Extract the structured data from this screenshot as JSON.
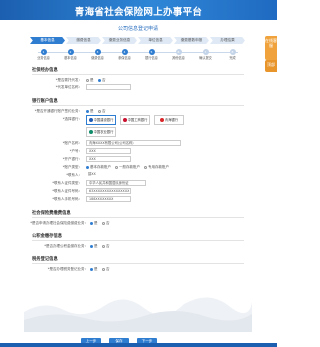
{
  "header": {
    "title": "青海省社会保险网上办事平台"
  },
  "side": {
    "btn1": "在线客服",
    "btn2": "顶部"
  },
  "form": {
    "title": "公司信息登记申请",
    "steps": [
      "基本信息",
      "缴费信息",
      "缴费业务信息",
      "单位信息",
      "缴费基数申报",
      "办理结果"
    ],
    "substeps": [
      "业务信息",
      "基本信息",
      "缴费信息",
      "参保信息",
      "银行信息",
      "其他信息",
      "确认提交",
      "完成"
    ],
    "sections": {
      "s1": "社保经办信息",
      "s2": "银行账户信息",
      "s3": "社会保险费缴费信息",
      "s4": "公积金缴存信息",
      "s5": "税务登记信息"
    },
    "fields": {
      "f1_label": "*是否委托代发：",
      "f1_opt1": "是",
      "f1_opt2": "否",
      "f2_label": "*代发单位名称：",
      "bank_q_label": "*是否开通银行账户签约业务：",
      "bank_q_opt1": "是",
      "bank_q_opt2": "否",
      "bank_label": "*选择银行：",
      "banks": [
        "中国建设银行",
        "中国工商银行",
        "青海银行",
        "中国农业银行"
      ],
      "acct_name_label": "*账户名称：",
      "acct_name_value": "青海XXXX有限公司(公司名称)",
      "acct_no_label": "*户号：",
      "acct_no_value": "XXX",
      "bank_name_label": "*开户银行：",
      "bank_name_value": "XXX",
      "type_label": "*账户类型：",
      "type_opts": [
        "基本存款账户",
        "一般存款账户",
        "专用存款账户"
      ],
      "contact_label": "*联系人：",
      "contact_value": "聂XX",
      "id_label": "*联系人证件类型：",
      "id_value": "中华人民共和国居民身份证",
      "idno_label": "*联系人证件号码：",
      "idno_value": "63XXXXXXXXXXXXXXXX",
      "phone_label": "*联系人手机号码：",
      "phone_value": "188XXXXXXXX",
      "ss_label": "*是否申请办理社会保险费缴费业务：",
      "ss_opt1": "是",
      "ss_opt2": "否",
      "gjj_label": "*是否办理公积金缴存业务：",
      "gjj_opt1": "是",
      "gjj_opt2": "否",
      "tax_label": "*是否办理税务登记业务：",
      "tax_opt1": "是",
      "tax_opt2": "否"
    },
    "buttons": {
      "prev": "上一步",
      "save": "保存",
      "next": "下一步"
    }
  },
  "colors": {
    "brand": "#2f7dd1",
    "side": "#f0a33c"
  }
}
